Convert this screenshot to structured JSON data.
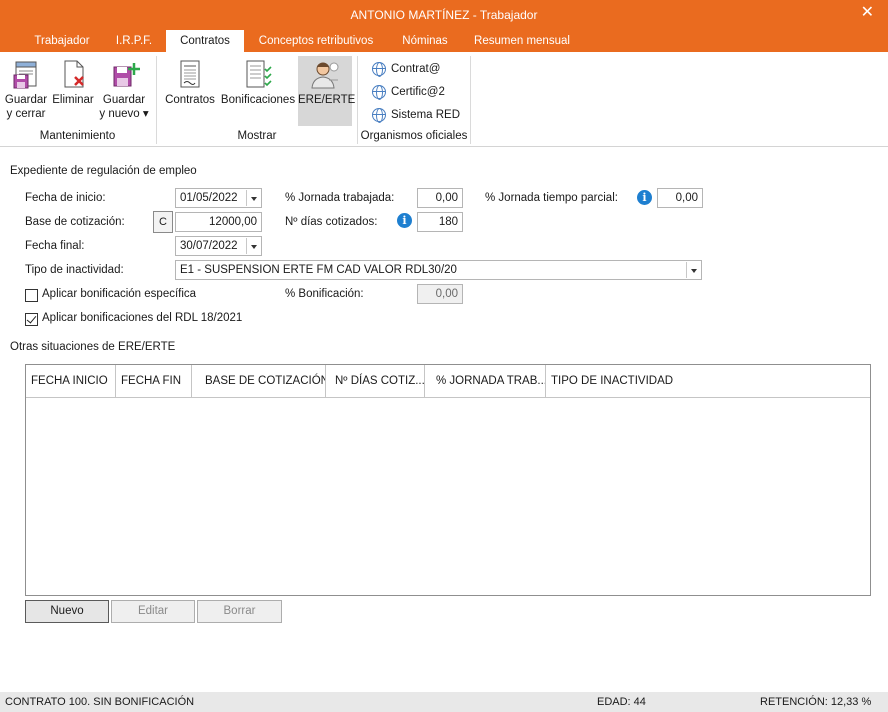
{
  "window": {
    "title": "ANTONIO MARTÍNEZ - Trabajador"
  },
  "tabs": [
    {
      "label": "Trabajador"
    },
    {
      "label": "I.R.P.F."
    },
    {
      "label": "Contratos"
    },
    {
      "label": "Conceptos retributivos"
    },
    {
      "label": "Nóminas"
    },
    {
      "label": "Resumen mensual"
    }
  ],
  "ribbon": {
    "mantenimiento": {
      "label": "Mantenimiento",
      "guardar_cerrar": [
        "Guardar",
        "y cerrar"
      ],
      "eliminar": "Eliminar",
      "guardar_nuevo": [
        "Guardar",
        "y nuevo ▾"
      ]
    },
    "mostrar": {
      "label": "Mostrar",
      "contratos": "Contratos",
      "bonificaciones": "Bonificaciones",
      "ere_erte": "ERE/ERTE"
    },
    "organismos": {
      "label": "Organismos oficiales",
      "contrata": "Contrat@",
      "certifica": "Certific@2",
      "sistema_red": "Sistema RED"
    }
  },
  "form": {
    "section_title": "Expediente de regulación de empleo",
    "fecha_inicio_label": "Fecha de inicio:",
    "fecha_inicio": "01/05/2022",
    "base_label": "Base de cotización:",
    "base_button": "C",
    "base_value": "12000,00",
    "fecha_final_label": "Fecha final:",
    "fecha_final": "30/07/2022",
    "tipo_label": "Tipo de inactividad:",
    "tipo_value": "E1 - SUSPENSION ERTE FM CAD VALOR RDL30/20",
    "jornada_trab_label": "% Jornada trabajada:",
    "jornada_trab_value": "0,00",
    "dias_label": "Nº días cotizados:",
    "dias_value": "180",
    "jornada_parcial_label": "% Jornada tiempo parcial:",
    "jornada_parcial_value": "0,00",
    "bonif_especifica_label": "Aplicar bonificación específica",
    "bonif_especifica_checked": false,
    "bonificacion_label": "% Bonificación:",
    "bonificacion_value": "0,00",
    "bonif_rdl_label": "Aplicar bonificaciones del RDL 18/2021",
    "bonif_rdl_checked": true
  },
  "otras": {
    "title": "Otras situaciones de ERE/ERTE",
    "columns": [
      "FECHA INICIO",
      "FECHA FIN",
      "BASE DE COTIZACIÓN",
      "Nº DÍAS COTIZ...",
      "% JORNADA TRAB...",
      "TIPO DE INACTIVIDAD"
    ],
    "rows": []
  },
  "buttons": {
    "nuevo": "Nuevo",
    "editar": "Editar",
    "borrar": "Borrar"
  },
  "status": {
    "contrato": "CONTRATO 100.  SIN BONIFICACIÓN",
    "edad": "EDAD: 44",
    "retencion": "RETENCIÓN: 12,33 %"
  },
  "colors": {
    "accent": "#ea6b1f",
    "info": "#1e7fd0"
  }
}
